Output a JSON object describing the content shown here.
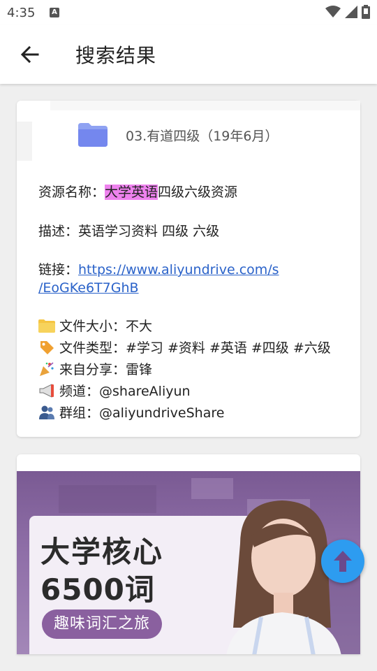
{
  "status": {
    "time": "4:35",
    "app_badge": "A"
  },
  "appbar": {
    "title": "搜索结果"
  },
  "result": {
    "folder_title": "03.有道四级（19年6月）",
    "name_label": "资源名称：",
    "name_highlight": "大学英语",
    "name_rest": "四级六级资源",
    "desc": "描述：英语学习资料 四级 六级",
    "link_label": "链接：",
    "link_line1": "https://www.aliyundrive.com/s",
    "link_line2": "/EoGKe6T7GhB",
    "size": "文件大小：不大",
    "type": "文件类型：#学习 #资料 #英语 #四级 #六级",
    "from": "来自分享：雷锋",
    "channel": "频道：@shareAliyun",
    "group": "群组：@aliyundriveShare"
  },
  "banner": {
    "line1": "大学核心",
    "line2": "6500词",
    "pill": "趣味词汇之旅"
  },
  "colors": {
    "accent": "#2d9cf0",
    "highlight": "#ee82ee",
    "link": "#2a62c9",
    "banner": "#8a609f"
  },
  "icons": [
    "back-arrow-icon",
    "wifi-icon",
    "signal-icon",
    "battery-icon",
    "folder-icon",
    "folder-emoji-icon",
    "tag-emoji-icon",
    "party-emoji-icon",
    "megaphone-emoji-icon",
    "people-emoji-icon",
    "arrow-up-icon"
  ]
}
